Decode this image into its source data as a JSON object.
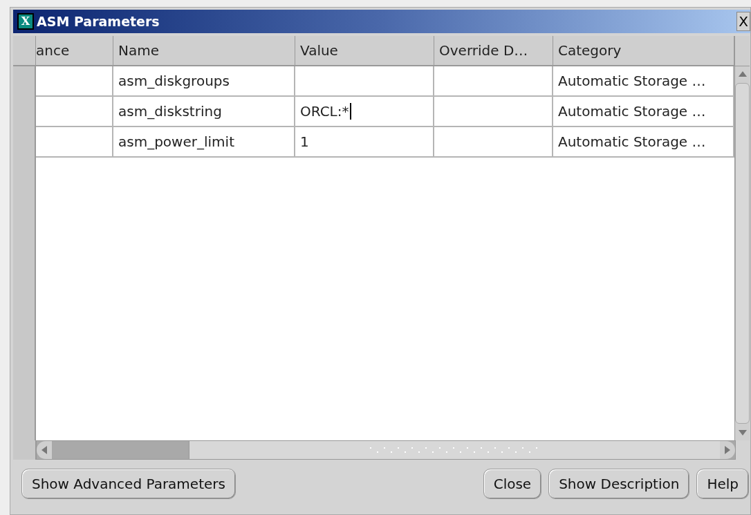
{
  "window": {
    "title": "ASM Parameters",
    "close": "X",
    "icon": "X"
  },
  "table": {
    "columns": [
      "ance",
      "Name",
      "Value",
      "Override D…",
      "Category"
    ],
    "rows": [
      {
        "cells": [
          "",
          "asm_diskgroups",
          "",
          "",
          "Automatic Storage …"
        ],
        "editing": false
      },
      {
        "cells": [
          "",
          "asm_diskstring",
          "ORCL:*",
          "",
          "Automatic Storage …"
        ],
        "editing": true
      },
      {
        "cells": [
          "",
          "asm_power_limit",
          "1",
          "",
          "Automatic Storage …"
        ],
        "editing": false
      }
    ]
  },
  "buttons_left": [
    "Show Advanced Parameters"
  ],
  "buttons_right": [
    "Close",
    "Show Description",
    "Help"
  ]
}
